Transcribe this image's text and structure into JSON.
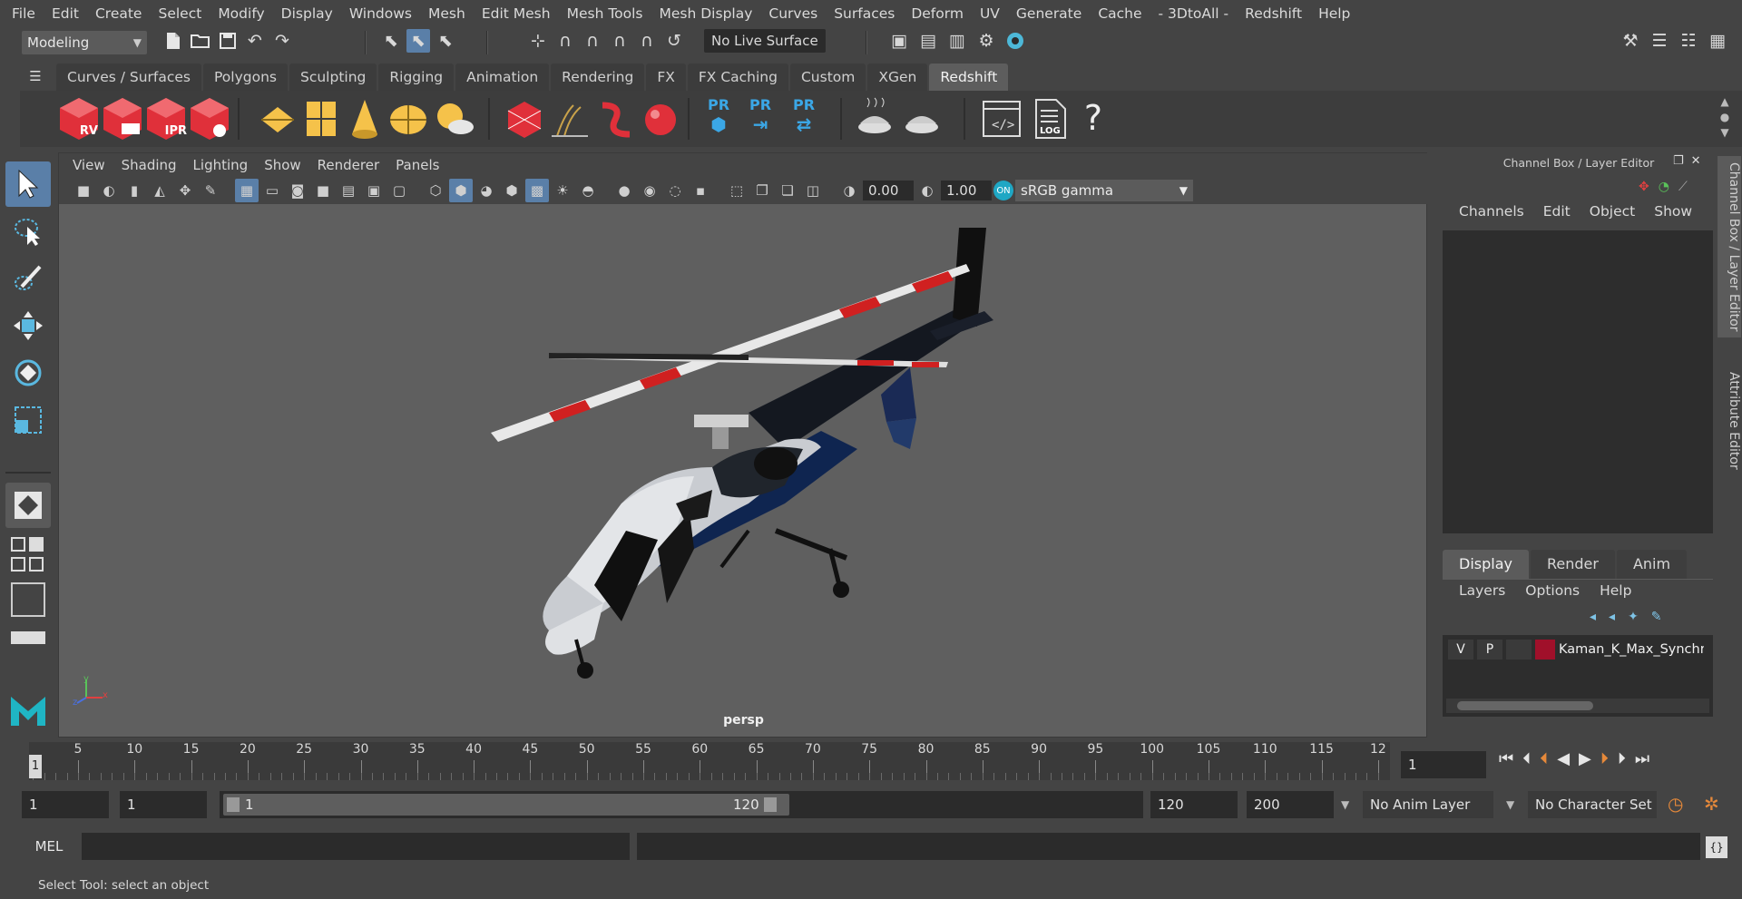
{
  "menubar": {
    "items": [
      "File",
      "Edit",
      "Create",
      "Select",
      "Modify",
      "Display",
      "Windows",
      "Mesh",
      "Edit Mesh",
      "Mesh Tools",
      "Mesh Display",
      "Curves",
      "Surfaces",
      "Deform",
      "UV",
      "Generate",
      "Cache",
      "- 3DtoAll -",
      "Redshift",
      "Help"
    ]
  },
  "statusline": {
    "mode": "Modeling",
    "live_surface": "No Live Surface"
  },
  "shelf": {
    "tabs": [
      "Curves / Surfaces",
      "Polygons",
      "Sculpting",
      "Rigging",
      "Animation",
      "Rendering",
      "FX",
      "FX Caching",
      "Custom",
      "XGen",
      "Redshift"
    ],
    "active_tab": "Redshift",
    "icon_labels": {
      "rv": "RV",
      "ipr": "IPR",
      "pr": "PR",
      "log": "LOG",
      "help": "?"
    }
  },
  "viewport": {
    "menu": [
      "View",
      "Shading",
      "Lighting",
      "Show",
      "Renderer",
      "Panels"
    ],
    "exposure": "0.00",
    "gamma": "1.00",
    "color_space": "sRGB gamma",
    "camera": "persp",
    "axis": {
      "y": "y",
      "x": "x",
      "z": "z"
    }
  },
  "channelbox": {
    "title": "Channel Box / Layer Editor",
    "menu": [
      "Channels",
      "Edit",
      "Object",
      "Show"
    ],
    "layer_tabs": [
      "Display",
      "Render",
      "Anim"
    ],
    "layer_menu": [
      "Layers",
      "Options",
      "Help"
    ],
    "layer": {
      "v": "V",
      "p": "P",
      "name": "Kaman_K_Max_Synchro",
      "color": "#a0102a"
    }
  },
  "side_tabs": [
    "Channel Box / Layer Editor",
    "Attribute Editor"
  ],
  "timeslider": {
    "ticks": [
      "5",
      "10",
      "15",
      "20",
      "25",
      "30",
      "35",
      "40",
      "45",
      "50",
      "55",
      "60",
      "65",
      "70",
      "75",
      "80",
      "85",
      "90",
      "95",
      "100",
      "105",
      "110",
      "115",
      "12"
    ],
    "current": "1",
    "current_frame_field": "1"
  },
  "range": {
    "start": "1",
    "playback_start": "1",
    "slider_start": "1",
    "slider_end": "120",
    "playback_end": "120",
    "end": "200",
    "anim_layer": "No Anim Layer",
    "char_set": "No Character Set"
  },
  "cmdline": {
    "label": "MEL"
  },
  "helpline": {
    "text": "Select Tool: select an object"
  },
  "colors": {
    "accent": "#5a7fa8",
    "redshift": "#e0303a",
    "background": "#444444",
    "viewport": "#5f5f5f"
  }
}
